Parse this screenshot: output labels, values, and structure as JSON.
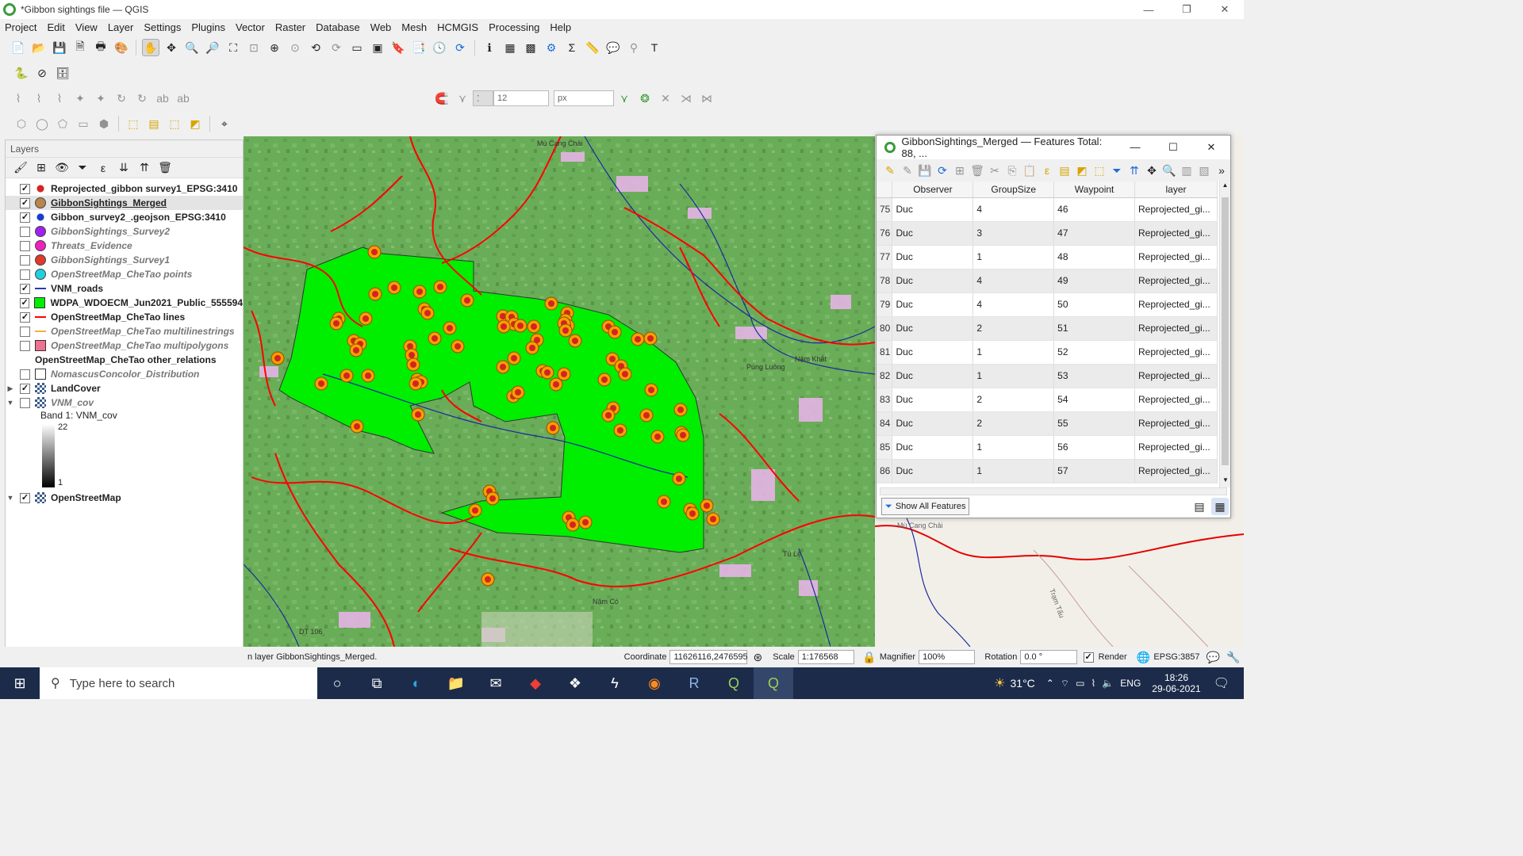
{
  "window": {
    "title": "*Gibbon sightings file — QGIS",
    "minimize": "—",
    "restore": "❐",
    "close": "✕"
  },
  "menu": [
    "Project",
    "Edit",
    "View",
    "Layer",
    "Settings",
    "Plugins",
    "Vector",
    "Raster",
    "Database",
    "Web",
    "Mesh",
    "HCMGIS",
    "Processing",
    "Help"
  ],
  "toolbar": {
    "snap_tolerance": "12",
    "snap_unit": "px"
  },
  "layers_panel": {
    "title": "Layers",
    "items": [
      {
        "label": "Reprojected_gibbon survey1_EPSG:3410",
        "checked": true,
        "symbol": "#d42323",
        "shape": "dot",
        "style": "bold"
      },
      {
        "label": "GibbonSightings_Merged",
        "checked": true,
        "symbol": "#b8864a",
        "shape": "circle",
        "style": "selected"
      },
      {
        "label": "Gibbon_survey2_.geojson_EPSG:3410",
        "checked": true,
        "symbol": "#1a3ccc",
        "shape": "dot",
        "style": "bold"
      },
      {
        "label": "GibbonSightings_Survey2",
        "checked": false,
        "symbol": "#a020f0",
        "shape": "circle",
        "style": "off"
      },
      {
        "label": "Threats_Evidence",
        "checked": false,
        "symbol": "#f020c0",
        "shape": "circle",
        "style": "off"
      },
      {
        "label": "GibbonSightings_Survey1",
        "checked": false,
        "symbol": "#e03a2a",
        "shape": "circle",
        "style": "off"
      },
      {
        "label": "OpenStreetMap_CheTao points",
        "checked": false,
        "symbol": "#20d0e0",
        "shape": "circle",
        "style": "off"
      },
      {
        "label": "VNM_roads",
        "checked": true,
        "symbol": "#2a3aa8",
        "shape": "line",
        "style": "bold"
      },
      {
        "label": "WDPA_WDOECM_Jun2021_Public_555594",
        "checked": true,
        "symbol": "#00ee00",
        "shape": "square",
        "style": "bold"
      },
      {
        "label": "OpenStreetMap_CheTao lines",
        "checked": true,
        "symbol": "#ff0000",
        "shape": "line",
        "style": "bold"
      },
      {
        "label": "OpenStreetMap_CheTao multilinestrings",
        "checked": false,
        "symbol": "#f0b040",
        "shape": "line",
        "style": "off"
      },
      {
        "label": "OpenStreetMap_CheTao multipolygons",
        "checked": false,
        "symbol": "#f07090",
        "shape": "square",
        "style": "off"
      },
      {
        "label": "OpenStreetMap_CheTao other_relations",
        "checked": null,
        "symbol": "#333333",
        "shape": "table",
        "style": "bold"
      },
      {
        "label": "NomascusConcolor_Distribution",
        "checked": false,
        "symbol": "#ffffff",
        "shape": "square",
        "style": "off"
      },
      {
        "label": "LandCover",
        "checked": true,
        "symbol": "#555555",
        "shape": "raster",
        "style": "bold",
        "expand": "▶"
      },
      {
        "label": "VNM_cov",
        "checked": false,
        "symbol": "#555555",
        "shape": "raster",
        "style": "off",
        "expand": "▼"
      }
    ],
    "band_label": "Band 1: VNM_cov",
    "band_max": "22",
    "band_min": "1",
    "osm_layer": "OpenStreetMap"
  },
  "attribute_table": {
    "title": "GibbonSightings_Merged — Features Total: 88, ...",
    "columns": [
      "Observer",
      "GroupSize",
      "Waypoint",
      "layer"
    ],
    "rows": [
      {
        "n": "75",
        "observer": "Duc",
        "group": "4",
        "waypoint": "46",
        "layer": "Reprojected_gi..."
      },
      {
        "n": "76",
        "observer": "Duc",
        "group": "3",
        "waypoint": "47",
        "layer": "Reprojected_gi..."
      },
      {
        "n": "77",
        "observer": "Duc",
        "group": "1",
        "waypoint": "48",
        "layer": "Reprojected_gi..."
      },
      {
        "n": "78",
        "observer": "Duc",
        "group": "4",
        "waypoint": "49",
        "layer": "Reprojected_gi..."
      },
      {
        "n": "79",
        "observer": "Duc",
        "group": "4",
        "waypoint": "50",
        "layer": "Reprojected_gi..."
      },
      {
        "n": "80",
        "observer": "Duc",
        "group": "2",
        "waypoint": "51",
        "layer": "Reprojected_gi..."
      },
      {
        "n": "81",
        "observer": "Duc",
        "group": "1",
        "waypoint": "52",
        "layer": "Reprojected_gi..."
      },
      {
        "n": "82",
        "observer": "Duc",
        "group": "1",
        "waypoint": "53",
        "layer": "Reprojected_gi..."
      },
      {
        "n": "83",
        "observer": "Duc",
        "group": "2",
        "waypoint": "54",
        "layer": "Reprojected_gi..."
      },
      {
        "n": "84",
        "observer": "Duc",
        "group": "2",
        "waypoint": "55",
        "layer": "Reprojected_gi..."
      },
      {
        "n": "85",
        "observer": "Duc",
        "group": "1",
        "waypoint": "56",
        "layer": "Reprojected_gi..."
      },
      {
        "n": "86",
        "observer": "Duc",
        "group": "1",
        "waypoint": "57",
        "layer": "Reprojected_gi..."
      }
    ],
    "filter_button": "Show All Features"
  },
  "map": {
    "place_labels": [
      "Mù Cang Chải",
      "Púng Luông",
      "Nậm Khắt",
      "Tú Lệ",
      "Nậm Có",
      "DT 106",
      "Sơn Lương",
      "Trạm Tấu"
    ]
  },
  "statusbar": {
    "message": "n layer GibbonSightings_Merged.",
    "coordinate_label": "Coordinate",
    "coordinate": "11626116,2476595",
    "scale_label": "Scale",
    "scale": "1:176568",
    "magnifier_label": "Magnifier",
    "magnifier": "100%",
    "rotation_label": "Rotation",
    "rotation": "0.0 °",
    "render_label": "Render",
    "crs": "EPSG:3857"
  },
  "taskbar": {
    "search_placeholder": "Type here to search",
    "temperature": "31°C",
    "lang": "ENG",
    "time": "18:26",
    "date": "29-06-2021"
  }
}
